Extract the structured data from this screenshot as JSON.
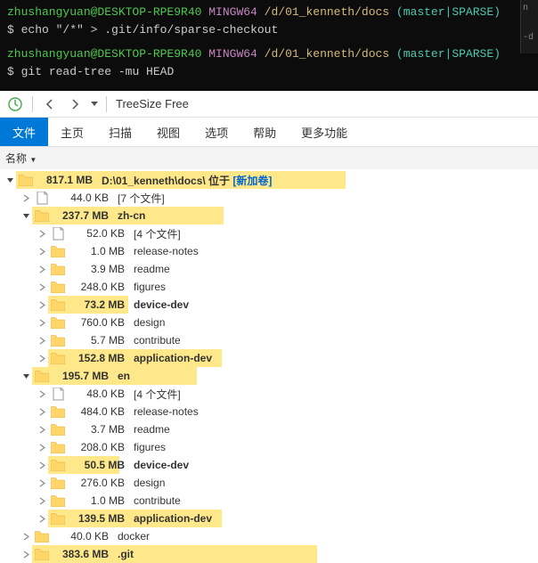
{
  "terminal": {
    "user": "zhushangyuan@DESKTOP-RPE9R40",
    "shell": "MINGW64",
    "path": "/d/01_kenneth/docs",
    "branch": "(master|SPARSE)",
    "prompt": "$",
    "cmd1": "echo \"/*\" > .git/info/sparse-checkout",
    "cmd2": "git read-tree -mu HEAD",
    "side_n": "n",
    "side_d": "-d"
  },
  "toolbar": {
    "title": "TreeSize Free"
  },
  "menu": {
    "file": "文件",
    "home": "主页",
    "scan": "扫描",
    "view": "视图",
    "options": "选项",
    "help": "帮助",
    "more": "更多功能"
  },
  "col_name": "名称",
  "rows": [
    {
      "indent": 0,
      "exp": "v",
      "type": "folder",
      "size": "817.1 MB",
      "name_prefix": "D:\\01_kenneth\\docs\\",
      "name_mid": " 位于 ",
      "name_loc": "[新加卷]",
      "bold": true,
      "hl": 370
    },
    {
      "indent": 1,
      "exp": ">",
      "type": "file",
      "size": "44.0 KB",
      "name": "[7 个文件]",
      "bold": false,
      "hl": 0
    },
    {
      "indent": 1,
      "exp": "v",
      "type": "folder",
      "size": "237.7 MB",
      "name": "zh-cn",
      "bold": true,
      "hl": 215
    },
    {
      "indent": 2,
      "exp": ">",
      "type": "file",
      "size": "52.0 KB",
      "name": "[4 个文件]",
      "bold": false,
      "hl": 0
    },
    {
      "indent": 2,
      "exp": ">",
      "type": "folder",
      "size": "1.0 MB",
      "name": "release-notes",
      "bold": false,
      "hl": 0
    },
    {
      "indent": 2,
      "exp": ">",
      "type": "folder",
      "size": "3.9 MB",
      "name": "readme",
      "bold": false,
      "hl": 0
    },
    {
      "indent": 2,
      "exp": ">",
      "type": "folder",
      "size": "248.0 KB",
      "name": "figures",
      "bold": false,
      "hl": 0
    },
    {
      "indent": 2,
      "exp": ">",
      "type": "folder",
      "size": "73.2 MB",
      "name": "device-dev",
      "bold": true,
      "hl": 90
    },
    {
      "indent": 2,
      "exp": ">",
      "type": "folder",
      "size": "760.0 KB",
      "name": "design",
      "bold": false,
      "hl": 0
    },
    {
      "indent": 2,
      "exp": ">",
      "type": "folder",
      "size": "5.7 MB",
      "name": "contribute",
      "bold": false,
      "hl": 0
    },
    {
      "indent": 2,
      "exp": ">",
      "type": "folder",
      "size": "152.8 MB",
      "name": "application-dev",
      "bold": true,
      "hl": 195
    },
    {
      "indent": 1,
      "exp": "v",
      "type": "folder",
      "size": "195.7 MB",
      "name": "en",
      "bold": true,
      "hl": 185
    },
    {
      "indent": 2,
      "exp": ">",
      "type": "file",
      "size": "48.0 KB",
      "name": "[4 个文件]",
      "bold": false,
      "hl": 0
    },
    {
      "indent": 2,
      "exp": ">",
      "type": "folder",
      "size": "484.0 KB",
      "name": "release-notes",
      "bold": false,
      "hl": 0
    },
    {
      "indent": 2,
      "exp": ">",
      "type": "folder",
      "size": "3.7 MB",
      "name": "readme",
      "bold": false,
      "hl": 0
    },
    {
      "indent": 2,
      "exp": ">",
      "type": "folder",
      "size": "208.0 KB",
      "name": "figures",
      "bold": false,
      "hl": 0
    },
    {
      "indent": 2,
      "exp": ">",
      "type": "folder",
      "size": "50.5 MB",
      "name": "device-dev",
      "bold": true,
      "hl": 80
    },
    {
      "indent": 2,
      "exp": ">",
      "type": "folder",
      "size": "276.0 KB",
      "name": "design",
      "bold": false,
      "hl": 0
    },
    {
      "indent": 2,
      "exp": ">",
      "type": "folder",
      "size": "1.0 MB",
      "name": "contribute",
      "bold": false,
      "hl": 0
    },
    {
      "indent": 2,
      "exp": ">",
      "type": "folder",
      "size": "139.5 MB",
      "name": "application-dev",
      "bold": true,
      "hl": 195
    },
    {
      "indent": 1,
      "exp": ">",
      "type": "folder",
      "size": "40.0 KB",
      "name": "docker",
      "bold": false,
      "hl": 0
    },
    {
      "indent": 1,
      "exp": ">",
      "type": "folder",
      "size": "383.6 MB",
      "name": ".git",
      "bold": true,
      "hl": 320
    }
  ]
}
